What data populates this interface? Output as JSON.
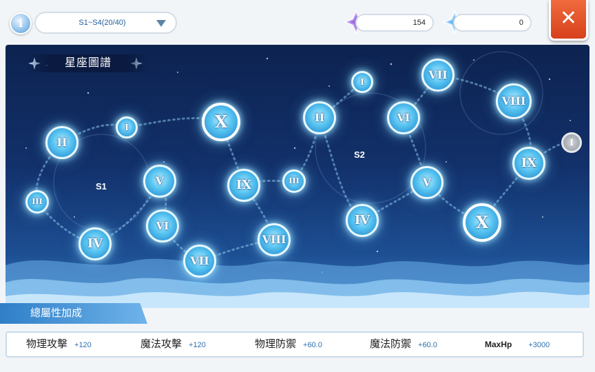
{
  "header": {
    "stage_selector": "S1~S4(20/40)",
    "currency_1_value": "154",
    "currency_2_value": "0",
    "info_glyph": "i",
    "close_glyph": "✕"
  },
  "map": {
    "title": "星座圖譜",
    "regions": [
      {
        "label": "S1"
      },
      {
        "label": "S2"
      }
    ],
    "nodes": [
      {
        "label": "II"
      },
      {
        "label": "I"
      },
      {
        "label": "III"
      },
      {
        "label": "V"
      },
      {
        "label": "VI"
      },
      {
        "label": "IV"
      },
      {
        "label": "VII"
      },
      {
        "label": "X"
      },
      {
        "label": "IX"
      },
      {
        "label": "III"
      },
      {
        "label": "VIII"
      },
      {
        "label": "I"
      },
      {
        "label": "II"
      },
      {
        "label": "VI"
      },
      {
        "label": "VII"
      },
      {
        "label": "VIII"
      },
      {
        "label": "V"
      },
      {
        "label": "IV"
      },
      {
        "label": "X"
      },
      {
        "label": "IX"
      },
      {
        "label": "I"
      }
    ]
  },
  "bonus": {
    "title": "總屬性加成",
    "stats": [
      {
        "name": "物理攻擊",
        "value": "+120"
      },
      {
        "name": "魔法攻擊",
        "value": "+120"
      },
      {
        "name": "物理防禦",
        "value": "+60.0"
      },
      {
        "name": "魔法防禦",
        "value": "+60.0"
      },
      {
        "name": "MaxHp",
        "value": "+3000"
      }
    ]
  },
  "colors": {
    "accent": "#2f7fc8",
    "close": "#e2542c",
    "node": "#55c2f0"
  }
}
